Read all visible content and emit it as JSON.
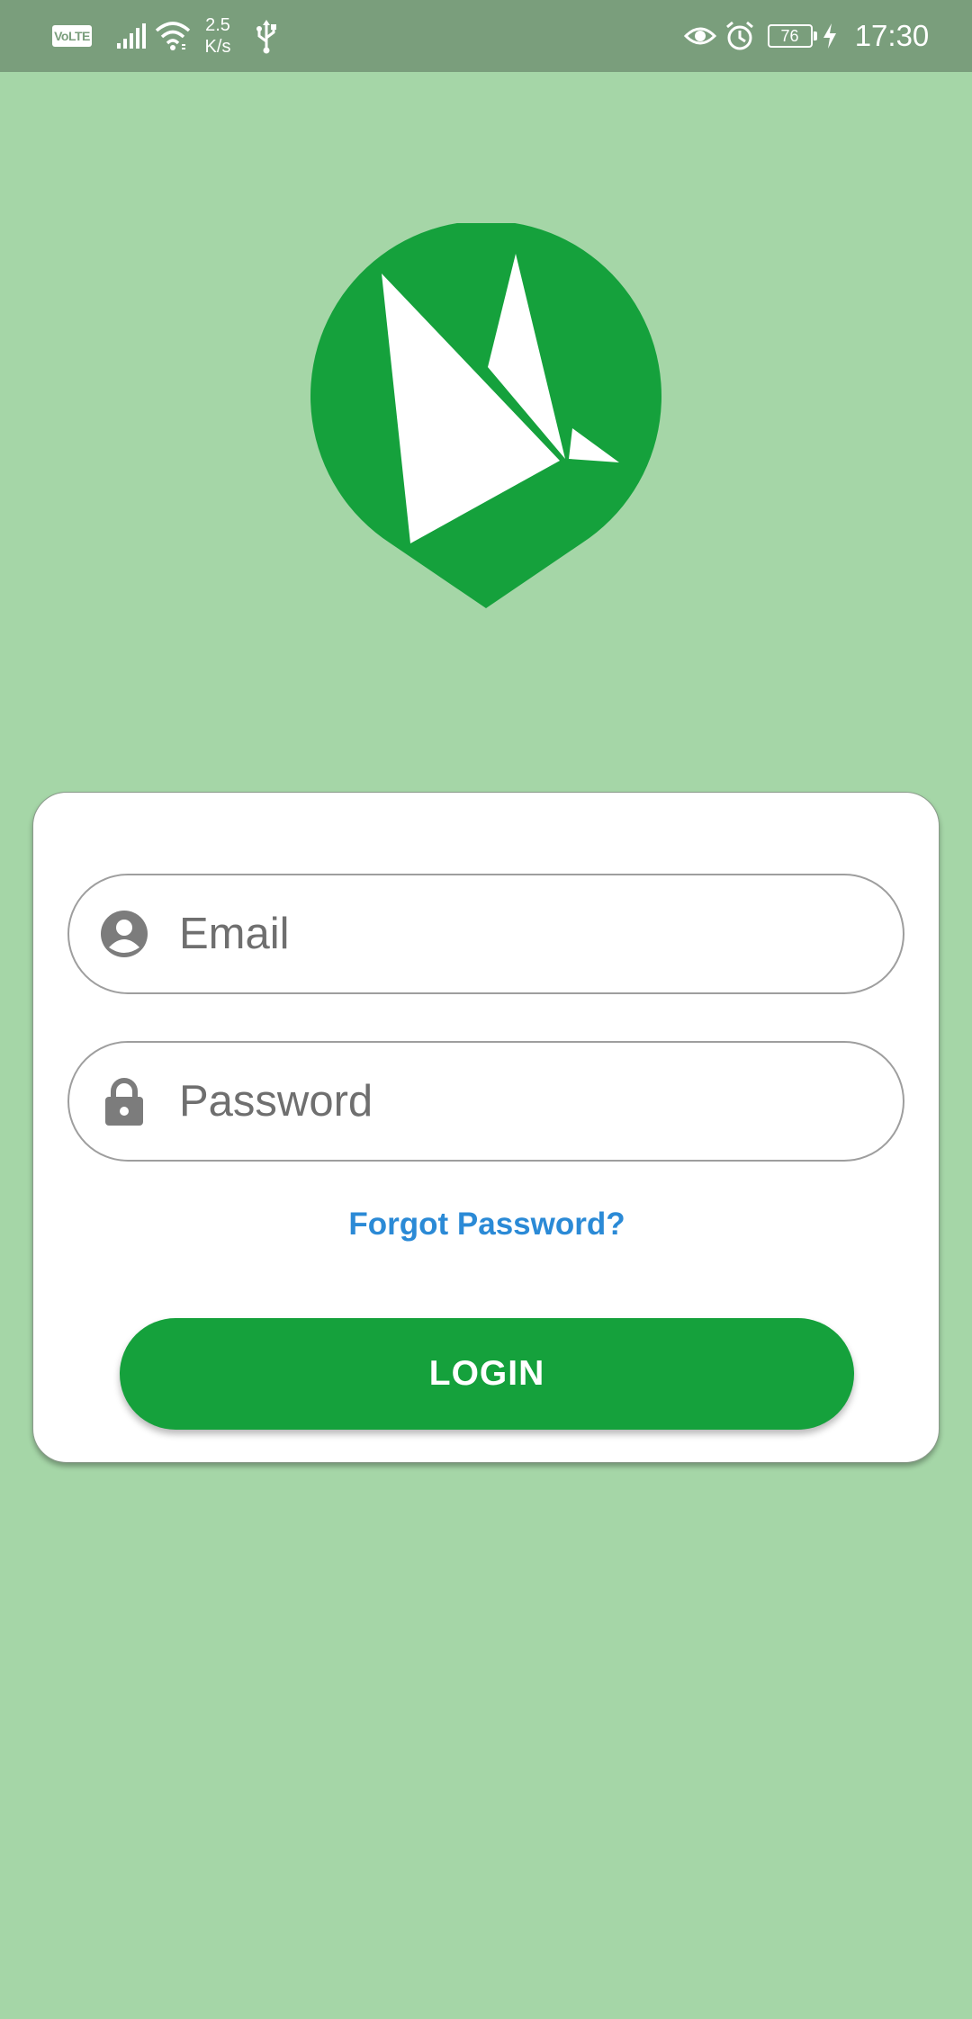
{
  "status_bar": {
    "network_badge": "VoLTE",
    "net_speed_value": "2.5",
    "net_speed_unit": "K/s",
    "battery_level": "76",
    "time": "17:30",
    "icons": [
      "volte-icon",
      "signal-icon",
      "wifi-icon",
      "usb-icon",
      "eye-icon",
      "alarm-icon",
      "battery-icon",
      "charging-icon"
    ]
  },
  "logo": {
    "icon": "sailboat-logo",
    "color": "#15a13c"
  },
  "login_form": {
    "email": {
      "icon": "person-icon",
      "placeholder": "Email",
      "value": ""
    },
    "password": {
      "icon": "lock-icon",
      "placeholder": "Password",
      "value": ""
    },
    "forgot_password_label": "Forgot Password?",
    "login_label": "LOGIN"
  },
  "colors": {
    "background": "#a5d6a7",
    "status_bar": "#7a9e7c",
    "primary": "#15a13c",
    "link": "#2b8ad6",
    "card": "#ffffff"
  }
}
